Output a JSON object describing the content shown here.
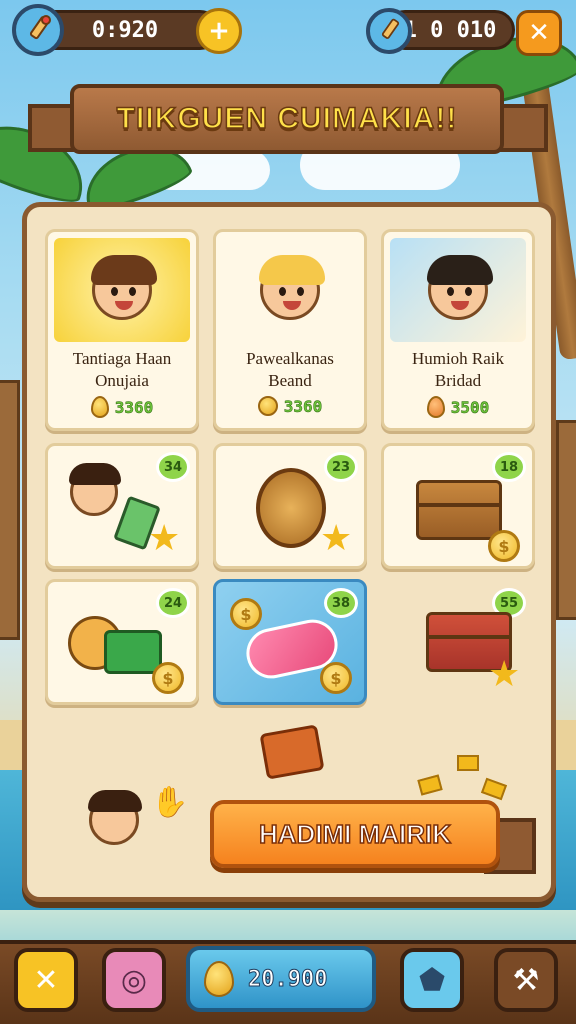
{
  "top_bar": {
    "left_counter": "0:920",
    "right_counter": "1 0 010"
  },
  "banner": {
    "title": "TIIKGUEN CUIMAKIA!!"
  },
  "shop": {
    "featured": [
      {
        "name_line1": "Tantiaga Haan",
        "name_line2": "Onujaia",
        "price": "3360"
      },
      {
        "name_line1": "Pawealkanas",
        "name_line2": "Beand",
        "price": "3360"
      },
      {
        "name_line1": "Humioh Raik",
        "name_line2": "Bridad",
        "price": "3500"
      }
    ],
    "items": [
      {
        "badge": "34"
      },
      {
        "badge": "23"
      },
      {
        "badge": "18"
      },
      {
        "badge": "24"
      },
      {
        "badge": "38"
      },
      {
        "badge": "55"
      }
    ]
  },
  "claim_button": {
    "label": "HADIMI MAIRIK"
  },
  "bottom_bar": {
    "currency_value": "20.900"
  },
  "colors": {
    "accent": "#f5821e",
    "price_green": "#6dc23a",
    "panel": "#f3e3c2"
  }
}
